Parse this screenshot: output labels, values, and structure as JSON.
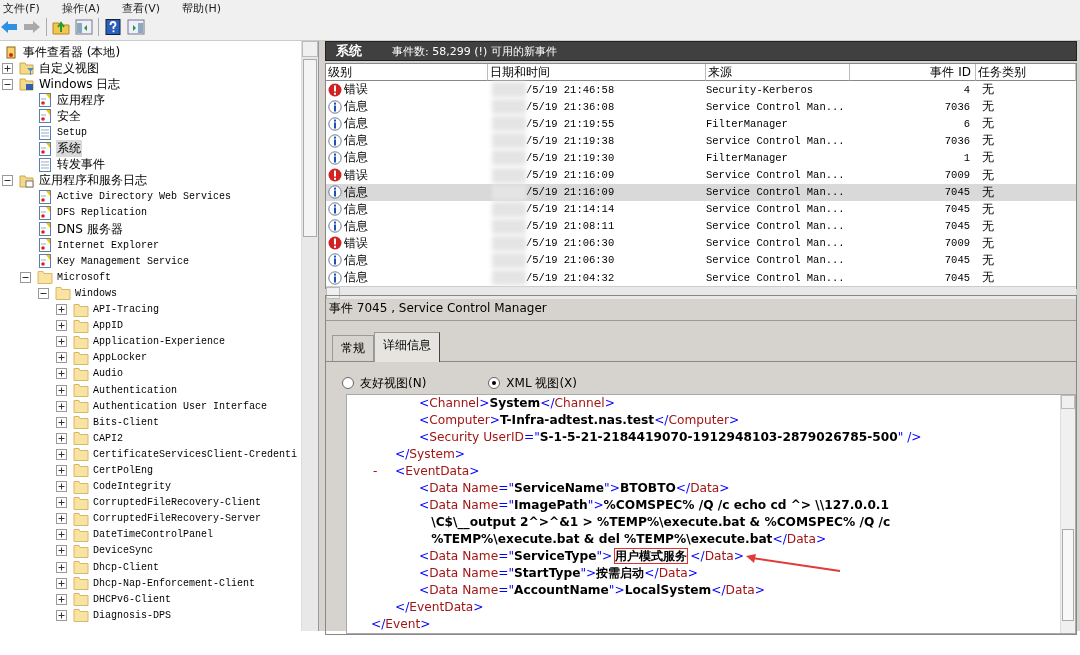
{
  "menu": [
    {
      "label": "文件(F)"
    },
    {
      "label": "操作(A)"
    },
    {
      "label": "查看(V)"
    },
    {
      "label": "帮助(H)"
    }
  ],
  "toolbar": [
    {
      "kind": "back",
      "disabled": false
    },
    {
      "kind": "forward",
      "disabled": true
    },
    {
      "kind": "sep"
    },
    {
      "kind": "up"
    },
    {
      "kind": "pane-left"
    },
    {
      "kind": "sep"
    },
    {
      "kind": "help"
    },
    {
      "kind": "pane-right"
    }
  ],
  "tree": {
    "label": "事件查看器 (本地)",
    "kind": "root",
    "children": [
      {
        "label": "自定义视图",
        "kind": "filter-folder",
        "expanded": false
      },
      {
        "label": "Windows 日志",
        "kind": "log-folder",
        "expanded": true,
        "children": [
          {
            "label": "应用程序",
            "kind": "log",
            "selected": false
          },
          {
            "label": "安全",
            "kind": "log",
            "selected": false
          },
          {
            "label": "Setup",
            "kind": "plain-log",
            "selected": false
          },
          {
            "label": "系统",
            "kind": "log",
            "selected": true
          },
          {
            "label": "转发事件",
            "kind": "plain-log",
            "selected": false
          }
        ]
      },
      {
        "label": "应用程序和服务日志",
        "kind": "app-folder",
        "expanded": true,
        "children": [
          {
            "label": "Active Directory Web Services",
            "kind": "log",
            "selected": false
          },
          {
            "label": "DFS Replication",
            "kind": "log",
            "selected": false
          },
          {
            "label": "DNS 服务器",
            "kind": "log",
            "selected": false
          },
          {
            "label": "Internet Explorer",
            "kind": "log",
            "selected": false
          },
          {
            "label": "Key Management Service",
            "kind": "log",
            "selected": false
          },
          {
            "label": "Microsoft",
            "kind": "folder",
            "expanded": true,
            "children": [
              {
                "label": "Windows",
                "kind": "folder",
                "expanded": true,
                "children": [
                  {
                    "label": "API-Tracing",
                    "kind": "folder",
                    "expanded": false
                  },
                  {
                    "label": "AppID",
                    "kind": "folder",
                    "expanded": false
                  },
                  {
                    "label": "Application-Experience",
                    "kind": "folder",
                    "expanded": false
                  },
                  {
                    "label": "AppLocker",
                    "kind": "folder",
                    "expanded": false
                  },
                  {
                    "label": "Audio",
                    "kind": "folder",
                    "expanded": false
                  },
                  {
                    "label": "Authentication",
                    "kind": "folder",
                    "expanded": false
                  },
                  {
                    "label": "Authentication User Interface",
                    "kind": "folder",
                    "expanded": false
                  },
                  {
                    "label": "Bits-Client",
                    "kind": "folder",
                    "expanded": false
                  },
                  {
                    "label": "CAPI2",
                    "kind": "folder",
                    "expanded": false
                  },
                  {
                    "label": "CertificateServicesClient-Credenti",
                    "kind": "folder",
                    "expanded": false
                  },
                  {
                    "label": "CertPolEng",
                    "kind": "folder",
                    "expanded": false
                  },
                  {
                    "label": "CodeIntegrity",
                    "kind": "folder",
                    "expanded": false
                  },
                  {
                    "label": "CorruptedFileRecovery-Client",
                    "kind": "folder",
                    "expanded": false
                  },
                  {
                    "label": "CorruptedFileRecovery-Server",
                    "kind": "folder",
                    "expanded": false
                  },
                  {
                    "label": "DateTimeControlPanel",
                    "kind": "folder",
                    "expanded": false
                  },
                  {
                    "label": "DeviceSync",
                    "kind": "folder",
                    "expanded": false
                  },
                  {
                    "label": "Dhcp-Client",
                    "kind": "folder",
                    "expanded": false
                  },
                  {
                    "label": "Dhcp-Nap-Enforcement-Client",
                    "kind": "folder",
                    "expanded": false
                  },
                  {
                    "label": "DHCPv6-Client",
                    "kind": "folder",
                    "expanded": false
                  },
                  {
                    "label": "Diagnosis-DPS",
                    "kind": "folder",
                    "expanded": false
                  }
                ]
              }
            ]
          }
        ]
      }
    ]
  },
  "log_header": {
    "title": "系统",
    "summary": "事件数: 58,299 (!) 可用的新事件"
  },
  "table": {
    "columns": [
      {
        "label": "级别"
      },
      {
        "label": "日期和时间"
      },
      {
        "label": "来源"
      },
      {
        "label": "事件 ID"
      },
      {
        "label": "任务类别"
      }
    ],
    "rows": [
      {
        "kind": "error",
        "level": "错误",
        "date": "/5/19 21:46:58",
        "source": "Security-Kerberos",
        "id": "4",
        "task": "无",
        "selected": false
      },
      {
        "kind": "info",
        "level": "信息",
        "date": "/5/19 21:36:08",
        "source": "Service Control Man...",
        "id": "7036",
        "task": "无",
        "selected": false
      },
      {
        "kind": "info",
        "level": "信息",
        "date": "/5/19 21:19:55",
        "source": "FilterManager",
        "id": "6",
        "task": "无",
        "selected": false
      },
      {
        "kind": "info",
        "level": "信息",
        "date": "/5/19 21:19:38",
        "source": "Service Control Man...",
        "id": "7036",
        "task": "无",
        "selected": false
      },
      {
        "kind": "info",
        "level": "信息",
        "date": "/5/19 21:19:30",
        "source": "FilterManager",
        "id": "1",
        "task": "无",
        "selected": false
      },
      {
        "kind": "error",
        "level": "错误",
        "date": "/5/19 21:16:09",
        "source": "Service Control Man...",
        "id": "7009",
        "task": "无",
        "selected": false
      },
      {
        "kind": "info",
        "level": "信息",
        "date": "/5/19 21:16:09",
        "source": "Service Control Man...",
        "id": "7045",
        "task": "无",
        "selected": true
      },
      {
        "kind": "info",
        "level": "信息",
        "date": "/5/19 21:14:14",
        "source": "Service Control Man...",
        "id": "7045",
        "task": "无",
        "selected": false
      },
      {
        "kind": "info",
        "level": "信息",
        "date": "/5/19 21:08:11",
        "source": "Service Control Man...",
        "id": "7045",
        "task": "无",
        "selected": false
      },
      {
        "kind": "error",
        "level": "错误",
        "date": "/5/19 21:06:30",
        "source": "Service Control Man...",
        "id": "7009",
        "task": "无",
        "selected": false
      },
      {
        "kind": "info",
        "level": "信息",
        "date": "/5/19 21:06:30",
        "source": "Service Control Man...",
        "id": "7045",
        "task": "无",
        "selected": false
      },
      {
        "kind": "info",
        "level": "信息",
        "date": "/5/19 21:04:32",
        "source": "Service Control Man...",
        "id": "7045",
        "task": "无",
        "selected": false
      }
    ]
  },
  "detail": {
    "title": "事件 7045 , Service Control Manager",
    "tabs": [
      {
        "label": "常规",
        "selected": false
      },
      {
        "label": "详细信息",
        "selected": true
      }
    ],
    "views": [
      {
        "label": "友好视图(N)",
        "selected": false
      },
      {
        "label": "XML 视图(X)",
        "selected": true
      }
    ],
    "xml": [
      {
        "children": [
          {
            "children": [
              {
                "text": "<Channel>System</Channel>"
              },
              {
                "text": "<Computer>T-Infra-adtest.nas.test</Computer>"
              },
              {
                "text": "<Security UserID=\"S-1-5-21-2184419070-1912948103-2879026785-500\" />"
              }
            ]
          },
          {
            "text": "</System>"
          },
          {
            "text": "<EventData>",
            "toggle": "-",
            "children": [
              {
                "text": "<Data Name=\"ServiceName\">BTOBTO</Data>"
              },
              {
                "text": "<Data Name=\"ImagePath\">%COMSPEC% /Q /c echo cd ^> \\\\127.0.0.1 \\C$\\__output 2^>^&1 > %TEMP%\\execute.bat & %COMSPEC% /Q /c %TEMP%\\execute.bat & del %TEMP%\\execute.bat</Data>"
              },
              {
                "text": "<Data Name=\"ServiceType\">用户模式服务</Data>",
                "highlighted": true
              },
              {
                "text": "<Data Name=\"StartType\">按需启动</Data>"
              },
              {
                "text": "<Data Name=\"AccountName\">LocalSystem</Data>"
              }
            ]
          },
          {
            "text": "</EventData>"
          }
        ]
      },
      {
        "text": "</Event>"
      }
    ]
  }
}
